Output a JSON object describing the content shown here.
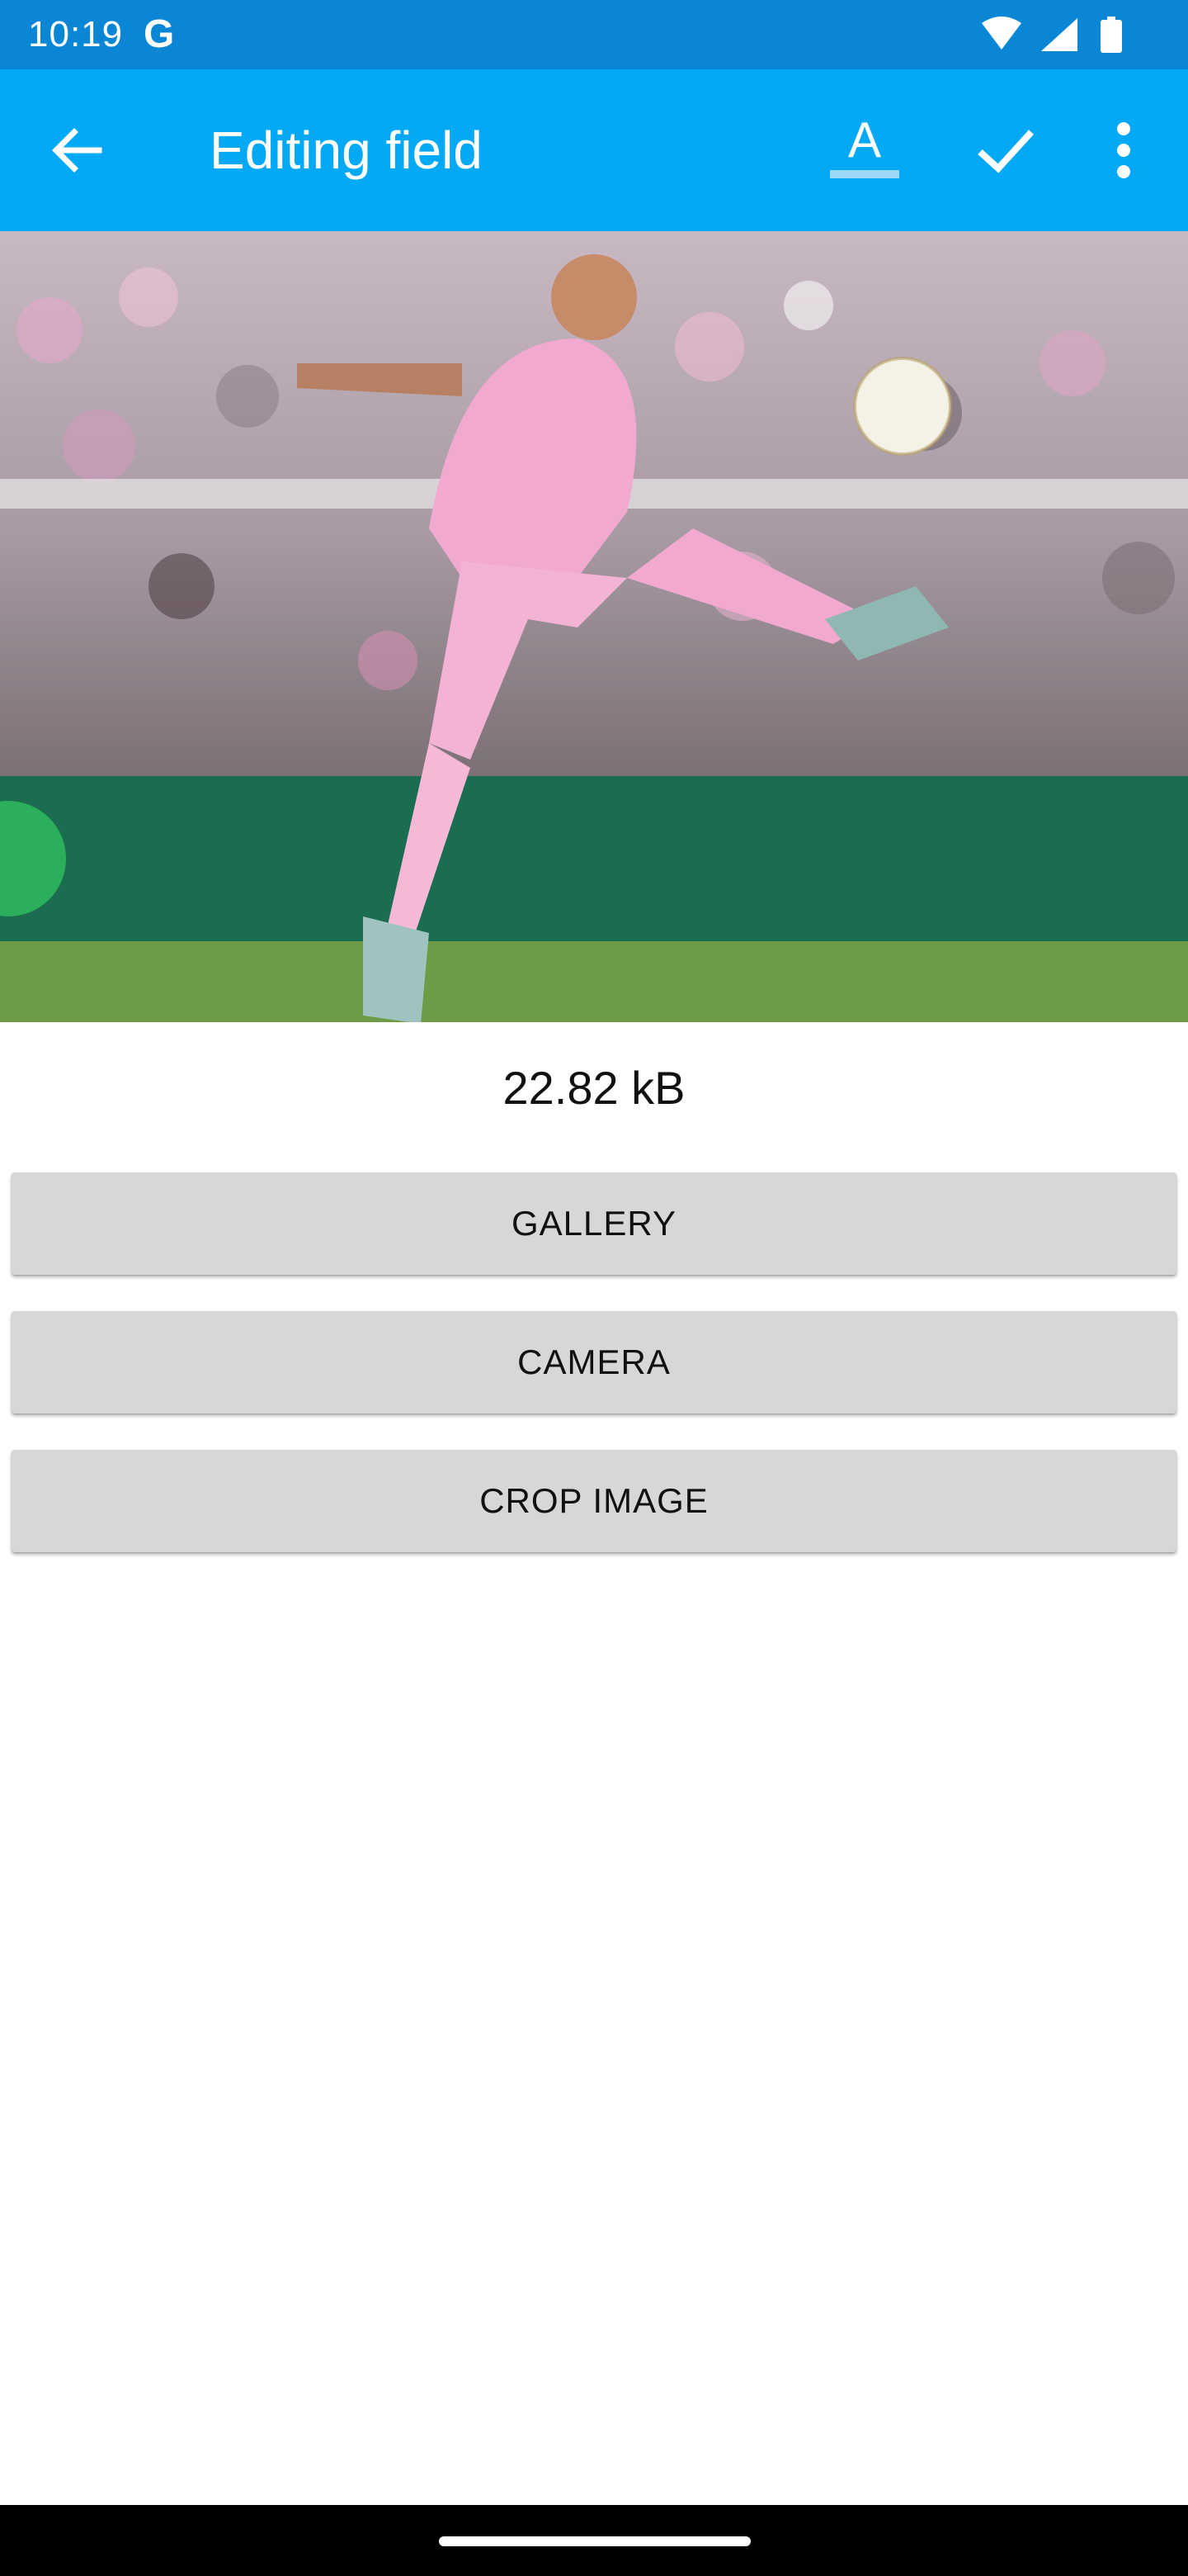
{
  "status_bar": {
    "time": "10:19",
    "google_badge": "G",
    "icons": [
      "wifi-icon",
      "cellular-signal-icon",
      "battery-icon"
    ]
  },
  "app_bar": {
    "title": "Editing field",
    "back_icon": "arrow-back-icon",
    "actions": [
      "text-format-icon",
      "check-icon",
      "more-vert-icon"
    ],
    "background_color": "#03a9f4",
    "status_color": "#0a86d4"
  },
  "image_field": {
    "image_description_icon": "photo-preview",
    "file_size": "22.82 kB"
  },
  "buttons": {
    "gallery": "GALLERY",
    "camera": "CAMERA",
    "crop": "CROP IMAGE"
  }
}
